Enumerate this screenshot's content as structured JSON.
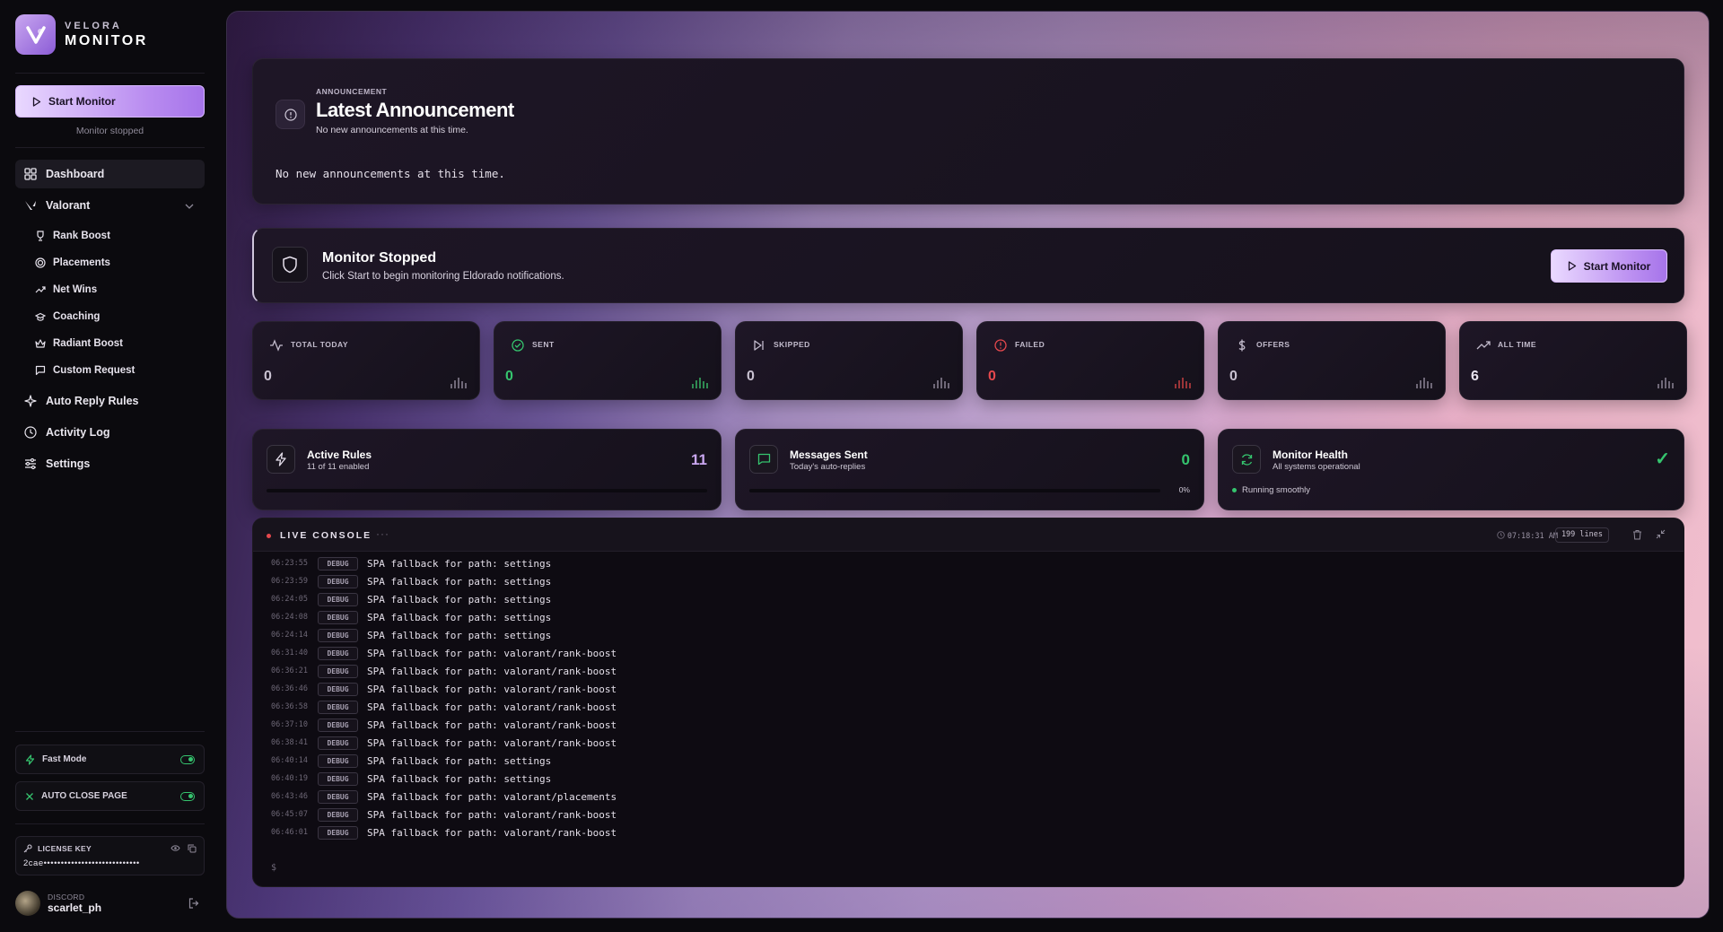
{
  "brand": {
    "line1": "VELORA",
    "line2": "MONITOR"
  },
  "sidebar": {
    "start_label": "Start Monitor",
    "status": "Monitor stopped",
    "nav": [
      {
        "label": "Dashboard",
        "icon": "grid-icon"
      },
      {
        "label": "Valorant",
        "icon": "valorant-icon"
      }
    ],
    "sub_items": [
      {
        "label": "Rank Boost",
        "icon": "trophy-icon"
      },
      {
        "label": "Placements",
        "icon": "target-icon"
      },
      {
        "label": "Net Wins",
        "icon": "trend-icon"
      },
      {
        "label": "Coaching",
        "icon": "cap-icon"
      },
      {
        "label": "Radiant Boost",
        "icon": "crown-icon"
      },
      {
        "label": "Custom Request",
        "icon": "chat-icon"
      }
    ],
    "nav2": [
      {
        "label": "Auto Reply Rules",
        "icon": "sparkle-icon"
      },
      {
        "label": "Activity Log",
        "icon": "clock-icon"
      },
      {
        "label": "Settings",
        "icon": "sliders-icon"
      }
    ],
    "fast_mode": "Fast Mode",
    "auto_close": "AUTO CLOSE PAGE",
    "license_label": "LICENSE KEY",
    "license_value": "2cae••••••••••••••••••••••••••••",
    "user_service": "DISCORD",
    "user_name": "scarlet_ph"
  },
  "announcement": {
    "eyebrow": "ANNOUNCEMENT",
    "title": "Latest Announcement",
    "subtitle": "No new announcements at this time.",
    "body": "No new announcements at this time."
  },
  "monitor": {
    "title": "Monitor Stopped",
    "subtitle": "Click Start to begin monitoring Eldorado notifications.",
    "button": "Start Monitor"
  },
  "stats": [
    {
      "label": "TOTAL TODAY",
      "value": "0",
      "color": "#c9c2d1"
    },
    {
      "label": "SENT",
      "value": "0",
      "color": "#35c46e"
    },
    {
      "label": "SKIPPED",
      "value": "0",
      "color": "#c9c2d1"
    },
    {
      "label": "FAILED",
      "value": "0",
      "color": "#e5484d"
    },
    {
      "label": "OFFERS",
      "value": "0",
      "color": "#c9c2d1"
    },
    {
      "label": "ALL TIME",
      "value": "6",
      "color": "#e8e4ef"
    }
  ],
  "wide": {
    "rules": {
      "title": "Active Rules",
      "sub": "11 of 11 enabled",
      "value": "11"
    },
    "messages": {
      "title": "Messages Sent",
      "sub": "Today's auto-replies",
      "value": "0",
      "pct": "0%"
    },
    "health": {
      "title": "Monitor Health",
      "sub": "All systems operational",
      "status": "Running smoothly",
      "check": "✓"
    }
  },
  "console": {
    "title": "LIVE CONSOLE",
    "dots": "···",
    "time": "07:18:31 AM",
    "lines": "199 lines",
    "prompt": "$",
    "logs": [
      {
        "t": "06:23:55",
        "lv": "DEBUG",
        "m": "SPA fallback for path: settings"
      },
      {
        "t": "06:23:59",
        "lv": "DEBUG",
        "m": "SPA fallback for path: settings"
      },
      {
        "t": "06:24:05",
        "lv": "DEBUG",
        "m": "SPA fallback for path: settings"
      },
      {
        "t": "06:24:08",
        "lv": "DEBUG",
        "m": "SPA fallback for path: settings"
      },
      {
        "t": "06:24:14",
        "lv": "DEBUG",
        "m": "SPA fallback for path: settings"
      },
      {
        "t": "06:31:40",
        "lv": "DEBUG",
        "m": "SPA fallback for path: valorant/rank-boost"
      },
      {
        "t": "06:36:21",
        "lv": "DEBUG",
        "m": "SPA fallback for path: valorant/rank-boost"
      },
      {
        "t": "06:36:46",
        "lv": "DEBUG",
        "m": "SPA fallback for path: valorant/rank-boost"
      },
      {
        "t": "06:36:58",
        "lv": "DEBUG",
        "m": "SPA fallback for path: valorant/rank-boost"
      },
      {
        "t": "06:37:10",
        "lv": "DEBUG",
        "m": "SPA fallback for path: valorant/rank-boost"
      },
      {
        "t": "06:38:41",
        "lv": "DEBUG",
        "m": "SPA fallback for path: valorant/rank-boost"
      },
      {
        "t": "06:40:14",
        "lv": "DEBUG",
        "m": "SPA fallback for path: settings"
      },
      {
        "t": "06:40:19",
        "lv": "DEBUG",
        "m": "SPA fallback for path: settings"
      },
      {
        "t": "06:43:46",
        "lv": "DEBUG",
        "m": "SPA fallback for path: valorant/placements"
      },
      {
        "t": "06:45:07",
        "lv": "DEBUG",
        "m": "SPA fallback for path: valorant/rank-boost"
      },
      {
        "t": "06:46:01",
        "lv": "DEBUG",
        "m": "SPA fallback for path: valorant/rank-boost"
      }
    ]
  },
  "colors": {
    "accent": "#b98cf0",
    "success": "#35c46e",
    "danger": "#e5484d"
  }
}
